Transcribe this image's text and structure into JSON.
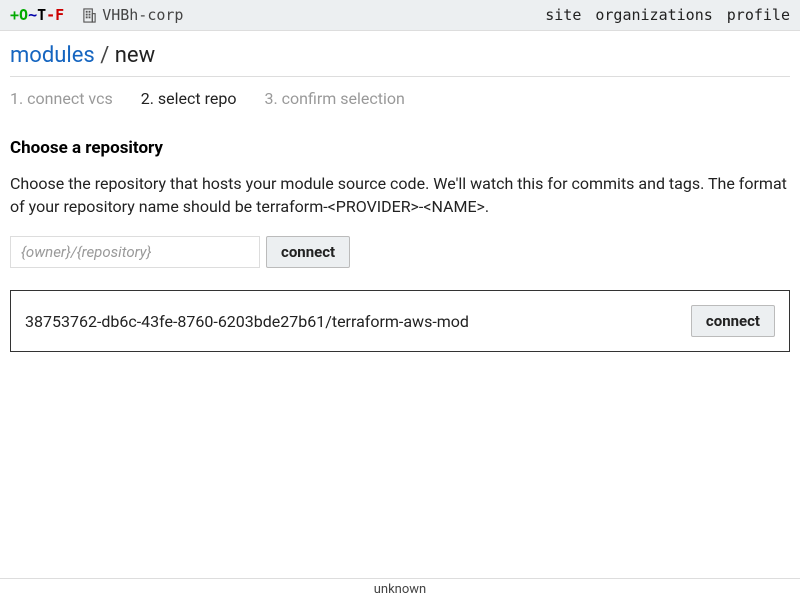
{
  "topbar": {
    "logo": {
      "plus": "+",
      "o": "O",
      "tilde": "~",
      "t": "T",
      "dash": "-",
      "f": "F"
    },
    "org_name": "VHBh-corp",
    "nav": {
      "site": "site",
      "organizations": "organizations",
      "profile": "profile"
    }
  },
  "breadcrumb": {
    "parent": "modules",
    "sep": "/",
    "current": "new"
  },
  "steps": {
    "s1": "1. connect vcs",
    "s2": "2. select repo",
    "s3": "3. confirm selection"
  },
  "section": {
    "title": "Choose a repository",
    "description": "Choose the repository that hosts your module source code. We'll watch this for commits and tags. The format of your repository name should be terraform-<PROVIDER>-<NAME>."
  },
  "search": {
    "placeholder": "{owner}/{repository}",
    "button": "connect"
  },
  "repos": [
    {
      "name": "38753762-db6c-43fe-8760-6203bde27b61/terraform-aws-mod",
      "button": "connect"
    }
  ],
  "footer": {
    "text": "unknown"
  }
}
